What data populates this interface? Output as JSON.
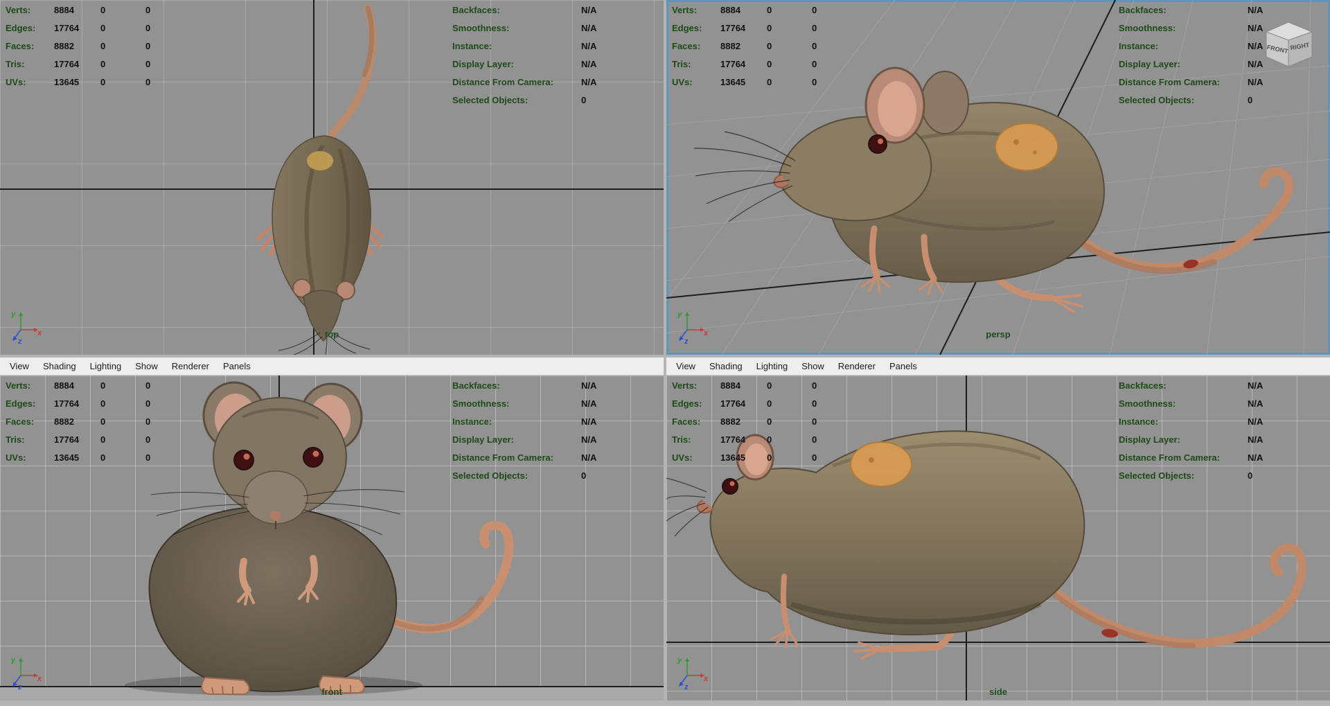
{
  "colors": {
    "viewport_bg": "#929292",
    "hud_label_green": "#1d4a17",
    "hud_value": "#101010",
    "active_panel_border": "#5e96b8",
    "menu_bg": "#eeeeee",
    "menu_text": "#1b1b1b",
    "viewport_label_green": "#1e4d1e",
    "axis_x_red": "#cc3a2f",
    "axis_y_green": "#2f9e2f",
    "axis_z_blue": "#2f52cc",
    "grid_dark_line": "#1d1d1d"
  },
  "hud": {
    "left_rows": [
      {
        "label": "Verts:",
        "values": [
          "8884",
          "0",
          "0"
        ]
      },
      {
        "label": "Edges:",
        "values": [
          "17764",
          "0",
          "0"
        ]
      },
      {
        "label": "Faces:",
        "values": [
          "8882",
          "0",
          "0"
        ]
      },
      {
        "label": "Tris:",
        "values": [
          "17764",
          "0",
          "0"
        ]
      },
      {
        "label": "UVs:",
        "values": [
          "13645",
          "0",
          "0"
        ]
      }
    ],
    "right_rows": [
      {
        "label": "Backfaces:",
        "value": "N/A"
      },
      {
        "label": "Smoothness:",
        "value": "N/A"
      },
      {
        "label": "Instance:",
        "value": "N/A"
      },
      {
        "label": "Display Layer:",
        "value": "N/A"
      },
      {
        "label": "Distance From Camera:",
        "value": "N/A"
      },
      {
        "label": "Selected Objects:",
        "value": "0"
      }
    ]
  },
  "menu_items": [
    "View",
    "Shading",
    "Lighting",
    "Show",
    "Renderer",
    "Panels"
  ],
  "viewports": [
    {
      "id": "top",
      "label": "top",
      "active": false
    },
    {
      "id": "persp",
      "label": "persp",
      "active": true
    },
    {
      "id": "front",
      "label": "front",
      "active": false
    },
    {
      "id": "side",
      "label": "side",
      "active": false
    }
  ],
  "axis": {
    "x": "x",
    "y": "y",
    "z": "z"
  },
  "viewcube": {
    "front_label": "FRONT",
    "right_label": "RIGHT"
  }
}
